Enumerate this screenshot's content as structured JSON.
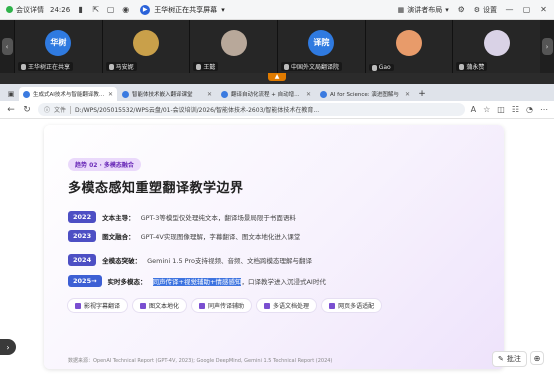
{
  "meeting_bar": {
    "status_label": "会议详情",
    "time": "24:26",
    "share_text": "王华树正在共享屏幕",
    "layout_label": "演讲者布局",
    "settings_label": "设置"
  },
  "participants": [
    {
      "name": "王华树正在共享",
      "avatar_text": "华树",
      "avatar_color": "#2f7ae0"
    },
    {
      "name": "马安妮",
      "avatar_text": "",
      "avatar_color": "#c9a04a"
    },
    {
      "name": "王懿",
      "avatar_text": "",
      "avatar_color": "#b8a89a"
    },
    {
      "name": "中国外文局翻译院",
      "avatar_text": "译院",
      "avatar_color": "#2f7ae0"
    },
    {
      "name": "Gao",
      "avatar_text": "",
      "avatar_color": "#e89b6a"
    },
    {
      "name": "蒲永赞",
      "avatar_text": "",
      "avatar_color": "#d9d2e6"
    }
  ],
  "tabs": [
    {
      "label": "生成式AI技术与智能翻译教学 - 翻译教学",
      "active": true
    },
    {
      "label": "智能体技术嵌入翻译课堂",
      "active": false
    },
    {
      "label": "翻译自动化流程 + 自动增能对照",
      "active": false
    },
    {
      "label": "AI for Science: 演进图解与",
      "active": false
    }
  ],
  "address": {
    "scheme": "文件",
    "url": "D:/WPS/205015532/WPS云盘/01-会议培训/2026/智能体技术-2603/智能体技术在教育..."
  },
  "slide": {
    "trend": "趋势 02 · 多模态融合",
    "title": "多模态感知重塑翻译教学边界",
    "timeline": [
      {
        "year": "2022",
        "key": "文本主导：",
        "desc": "GPT-3等模型仅处理纯文本，翻译场景局限于书面语料"
      },
      {
        "year": "2023",
        "key": "图文融合：",
        "desc": "GPT-4V实现图像理解，字幕翻译、图文本地化进入课堂"
      },
      {
        "year": "2024",
        "key": "全模态突破：",
        "desc": "Gemini 1.5 Pro支持视频、音频、文档跨模态理解与翻译"
      },
      {
        "year": "2025→",
        "key": "实时多模态：",
        "selected": "同声传译+视觉辅助+情感感知",
        "desc": "，口译教学进入沉浸式AI时代"
      }
    ],
    "chips": [
      "影视字幕翻译",
      "图文本地化",
      "同声传译辅助",
      "多语文档处理",
      "网页多语适配"
    ],
    "source": "数据来源：OpenAI Technical Report (GPT-4V, 2023); Google DeepMind, Gemini 1.5 Technical Report (2024)"
  },
  "controls": {
    "annotate_label": "批注"
  }
}
